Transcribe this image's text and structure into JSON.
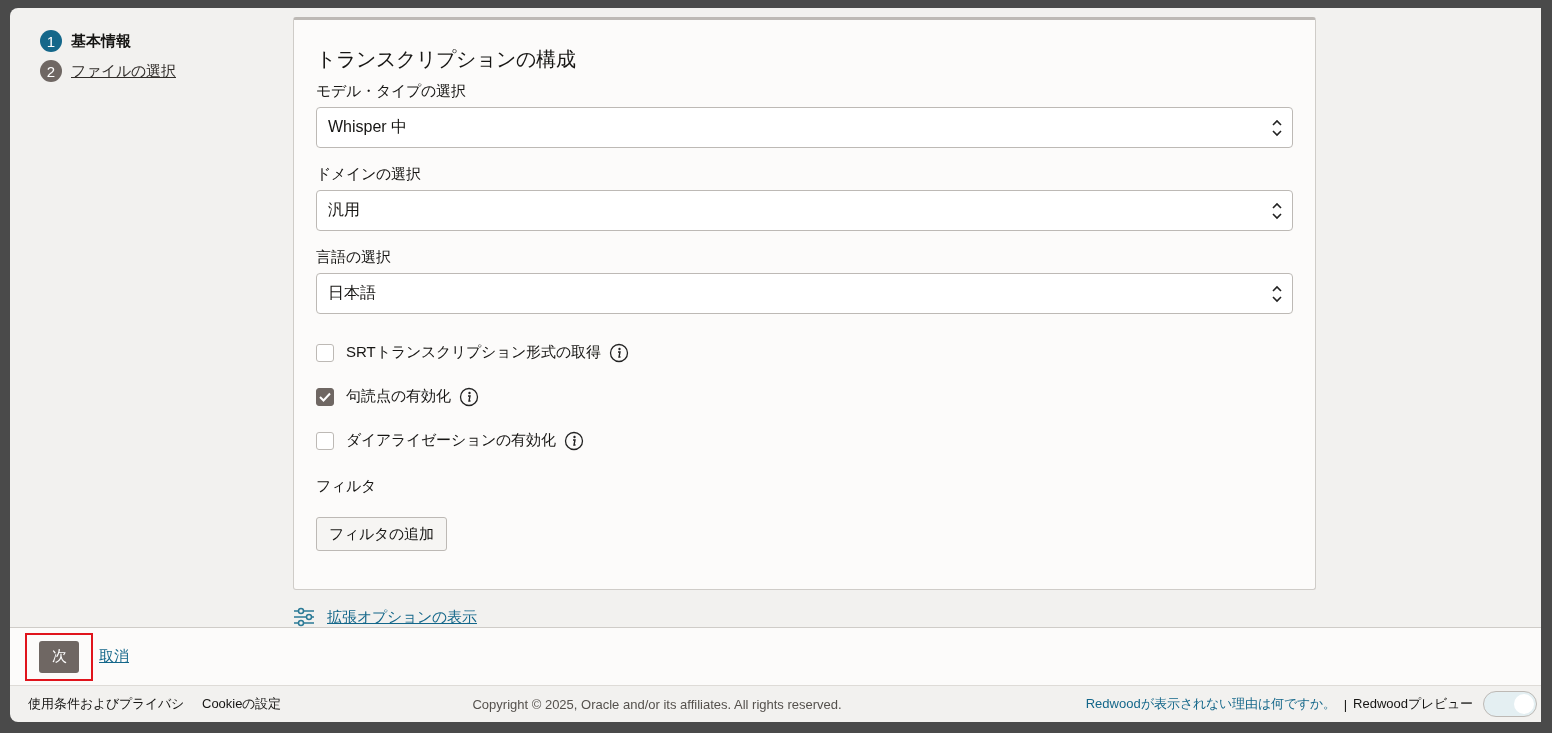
{
  "steps": [
    {
      "number": "1",
      "label": "基本情報",
      "selected": true
    },
    {
      "number": "2",
      "label": "ファイルの選択",
      "selected": false
    }
  ],
  "card": {
    "title": "トランスクリプションの構成",
    "selects": [
      {
        "label": "モデル・タイプの選択",
        "value": "Whisper 中"
      },
      {
        "label": "ドメインの選択",
        "value": "汎用"
      },
      {
        "label": "言語の選択",
        "value": "日本語"
      }
    ],
    "checkboxes": [
      {
        "label": "SRTトランスクリプション形式の取得",
        "checked": false
      },
      {
        "label": "句読点の有効化",
        "checked": true
      },
      {
        "label": "ダイアライゼーションの有効化",
        "checked": false
      }
    ],
    "filter_label": "フィルタ",
    "filter_button": "フィルタの追加"
  },
  "advanced_link": "拡張オプションの表示",
  "actions": {
    "next": {
      "label": "次",
      "highlighted": true
    },
    "cancel": "取消"
  },
  "footer": {
    "links": [
      "使用条件およびプライバシ",
      "Cookieの設定"
    ],
    "copyright": "Copyright © 2025, Oracle and/or its affiliates. All rights reserved.",
    "redwood_link": "Redwoodが表示されない理由は何ですか。",
    "separator": "|",
    "preview_label": "Redwoodプレビュー",
    "preview_on": true
  }
}
